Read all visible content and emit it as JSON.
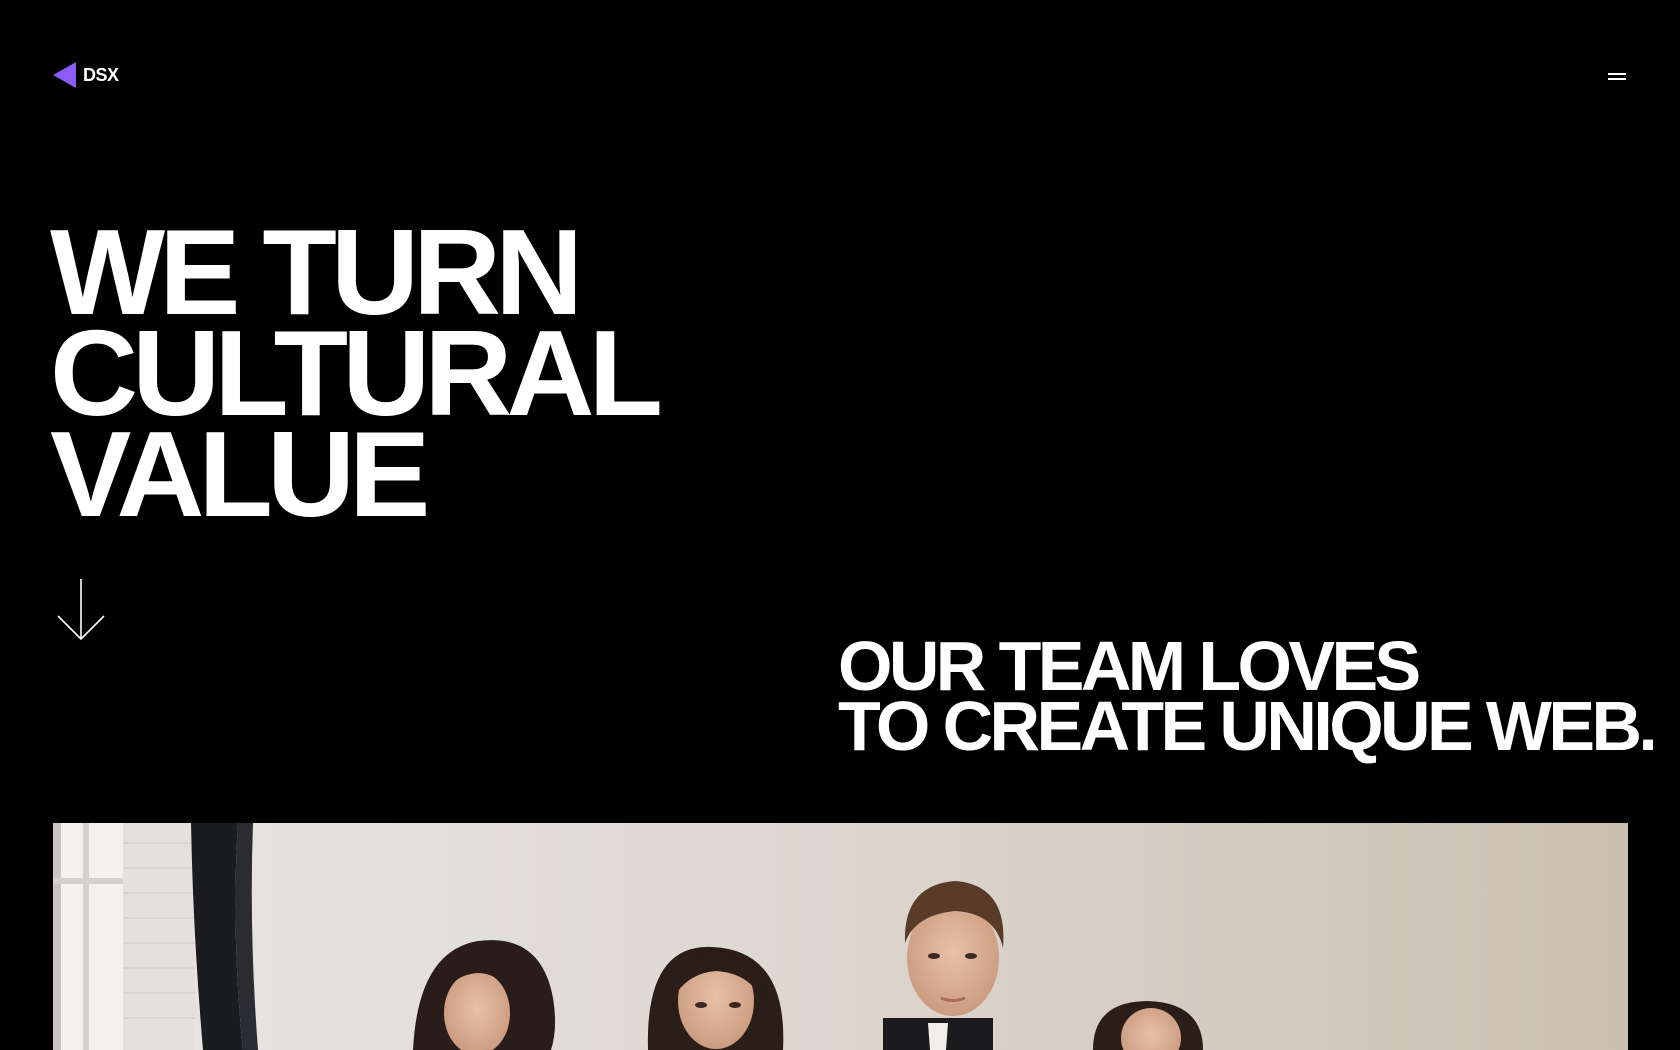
{
  "header": {
    "logo_text": "DSX",
    "logo_color": "#8B5CF6",
    "menu_icon": "hamburger-menu-icon"
  },
  "hero": {
    "title_lines": [
      "WE TURN",
      "CULTURAL",
      "VALUE"
    ],
    "scroll_icon": "arrow-down-icon"
  },
  "tagline": {
    "lines": [
      "OUR TEAM LOVES",
      "TO CREATE UNIQUE WEB."
    ]
  },
  "colors": {
    "background": "#000000",
    "text": "#FFFFFF",
    "accent": "#8B5CF6"
  }
}
